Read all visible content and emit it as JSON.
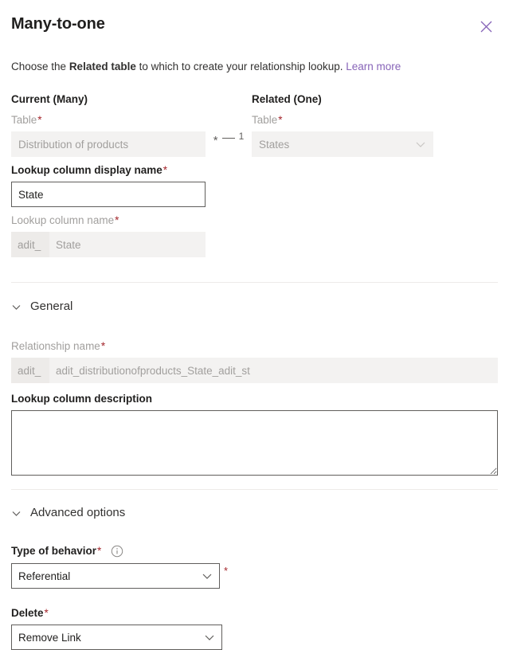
{
  "header": {
    "title": "Many-to-one",
    "close_icon": "close-icon"
  },
  "subtitle": {
    "text_before": "Choose the ",
    "emphasis": "Related table",
    "text_after": " to which to create your relationship lookup. ",
    "link_label": "Learn more",
    "link_color": "#8764b8"
  },
  "current_many": {
    "group_title": "Current (Many)",
    "table_label": "Table",
    "table_required": "*",
    "table_value": "Distribution of products",
    "lookup_display_label": "Lookup column display name",
    "lookup_display_required": "*",
    "lookup_display_value": "State",
    "lookup_name_label": "Lookup column name",
    "lookup_name_required": "*",
    "lookup_name_prefix": "adit_",
    "lookup_name_value": "State"
  },
  "cardinality": {
    "many_symbol": "*",
    "one_symbol": "1"
  },
  "related_one": {
    "group_title": "Related (One)",
    "table_label": "Table",
    "table_required": "*",
    "table_value": "States",
    "chevron_icon": "chevron-down-icon"
  },
  "general": {
    "section_label": "General",
    "chevron_icon": "chevron-down-icon",
    "relationship_name_label": "Relationship name",
    "relationship_name_required": "*",
    "relationship_name_prefix": "adit_",
    "relationship_name_value": "adit_distributionofproducts_State_adit_st",
    "description_label": "Lookup column description",
    "description_value": "",
    "description_placeholder": ""
  },
  "advanced": {
    "section_label": "Advanced options",
    "chevron_icon": "chevron-down-icon",
    "behavior_label": "Type of behavior",
    "behavior_required": "*",
    "behavior_info_icon": "info-icon",
    "behavior_value": "Referential",
    "behavior_star": "*",
    "delete_label": "Delete",
    "delete_required": "*",
    "delete_value": "Remove Link"
  },
  "colors": {
    "required_red": "#a4262c",
    "link_purple": "#8764b8",
    "border_gray": "#605e5c",
    "disabled_bg": "#f3f2f1",
    "prefix_bg": "#edebe9"
  }
}
